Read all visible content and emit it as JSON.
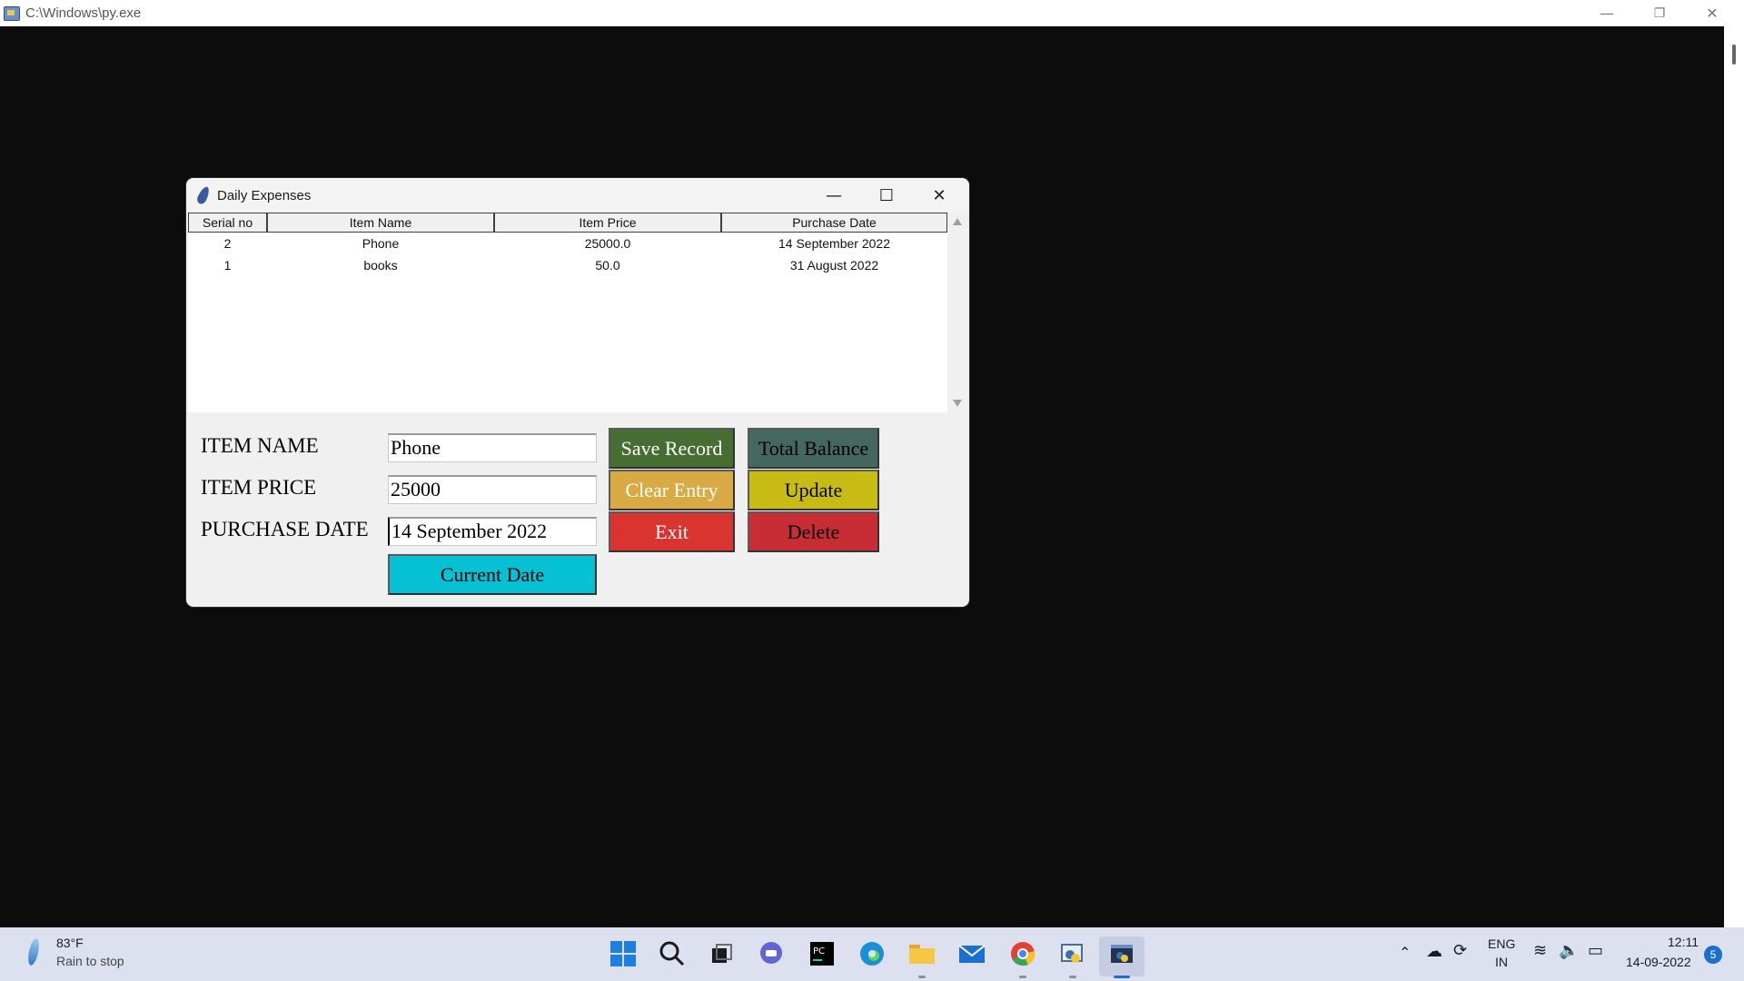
{
  "console": {
    "title": "C:\\Windows\\py.exe",
    "controls": {
      "minimize": "—",
      "restore": "❐",
      "close": "✕"
    }
  },
  "app": {
    "title": "Daily Expenses",
    "controls": {
      "minimize": "—",
      "maximize": "☐",
      "close": "✕"
    },
    "table": {
      "columns": [
        "Serial no",
        "Item Name",
        "Item Price",
        "Purchase Date"
      ],
      "rows": [
        [
          "2",
          "Phone",
          "25000.0",
          "14 September 2022"
        ],
        [
          "1",
          "books",
          "50.0",
          "31 August 2022"
        ]
      ]
    },
    "form": {
      "item_name_label": "ITEM NAME",
      "item_price_label": "ITEM PRICE",
      "purchase_date_label": "PURCHASE DATE",
      "item_name_value": "Phone",
      "item_price_value": "25000",
      "purchase_date_value": "14 September 2022"
    },
    "buttons": {
      "current_date": "Current Date",
      "save_record": "Save Record",
      "total_balance": "Total Balance",
      "clear_entry": "Clear Entry",
      "update": "Update",
      "exit": "Exit",
      "delete": "Delete"
    },
    "colors": {
      "save_record": "#466e32",
      "total_balance": "#44675f",
      "clear_entry": "#d9aa43",
      "update": "#c8bc14",
      "exit": "#d9342f",
      "delete": "#c62e33",
      "current_date": "#06c1d3"
    }
  },
  "taskbar": {
    "weather_temp": "83°F",
    "weather_desc": "Rain to stop",
    "language": "ENG",
    "region": "IN",
    "time": "12:11",
    "date": "14-09-2022",
    "notifications": "5",
    "icons": [
      "windows-start-icon",
      "search-icon",
      "task-view-icon",
      "chat-icon",
      "pycharm-icon",
      "edge-icon",
      "file-explorer-icon",
      "mail-icon",
      "chrome-icon",
      "python-idle-icon",
      "python-launcher-icon"
    ]
  }
}
